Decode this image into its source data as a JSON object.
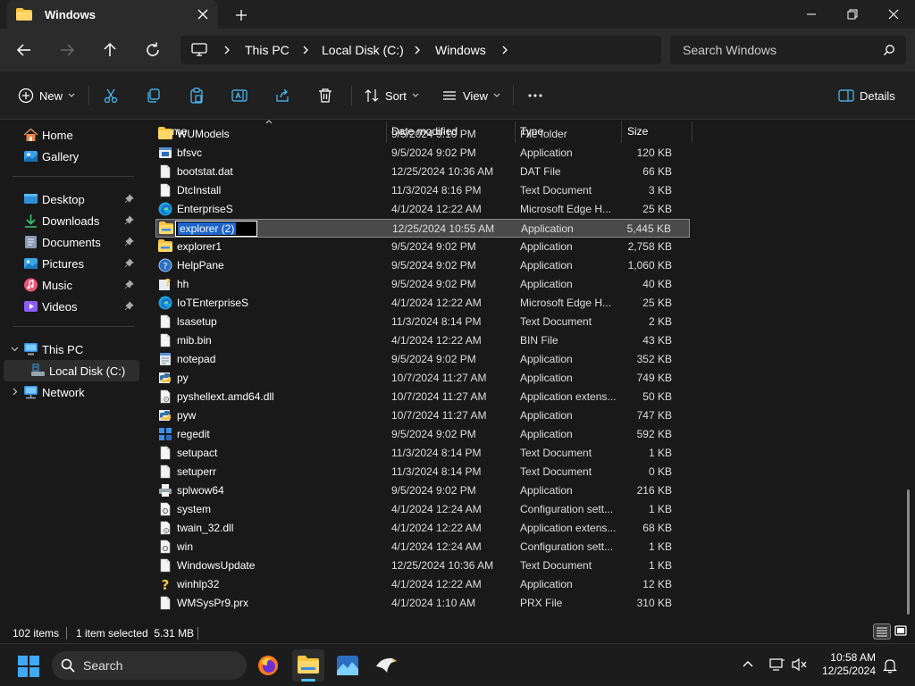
{
  "window": {
    "tab_title": "Windows",
    "controls": [
      "minimize",
      "maximize",
      "close"
    ]
  },
  "address_bar": {
    "breadcrumbs": [
      "This PC",
      "Local Disk (C:)",
      "Windows"
    ]
  },
  "search": {
    "placeholder": "Search Windows"
  },
  "toolbar": {
    "new_label": "New",
    "sort_label": "Sort",
    "view_label": "View",
    "details_label": "Details"
  },
  "sidebar": {
    "quick": [
      {
        "label": "Home",
        "icon": "home-icon"
      },
      {
        "label": "Gallery",
        "icon": "gallery-icon"
      }
    ],
    "pinned": [
      {
        "label": "Desktop",
        "icon": "desktop-icon"
      },
      {
        "label": "Downloads",
        "icon": "downloads-icon"
      },
      {
        "label": "Documents",
        "icon": "documents-icon"
      },
      {
        "label": "Pictures",
        "icon": "pictures-icon"
      },
      {
        "label": "Music",
        "icon": "music-icon"
      },
      {
        "label": "Videos",
        "icon": "videos-icon"
      }
    ],
    "this_pc": "This PC",
    "local_disk": "Local Disk (C:)",
    "network": "Network"
  },
  "columns": {
    "name": "Name",
    "date": "Date modified",
    "type": "Type",
    "size": "Size"
  },
  "files": [
    {
      "name": "WUModels",
      "date": "9/5/2024 9:10 PM",
      "type": "File folder",
      "size": "",
      "icon": "folder"
    },
    {
      "name": "bfsvc",
      "date": "9/5/2024 9:02 PM",
      "type": "Application",
      "size": "120 KB",
      "icon": "app"
    },
    {
      "name": "bootstat.dat",
      "date": "12/25/2024 10:36 AM",
      "type": "DAT File",
      "size": "66 KB",
      "icon": "doc"
    },
    {
      "name": "DtcInstall",
      "date": "11/3/2024 8:16 PM",
      "type": "Text Document",
      "size": "3 KB",
      "icon": "doc"
    },
    {
      "name": "EnterpriseS",
      "date": "4/1/2024 12:22 AM",
      "type": "Microsoft Edge H...",
      "size": "25 KB",
      "icon": "edge"
    },
    {
      "name": "explorer (2)",
      "date": "12/25/2024 10:55 AM",
      "type": "Application",
      "size": "5,445 KB",
      "icon": "explorer",
      "selected": true
    },
    {
      "name": "explorer1",
      "date": "9/5/2024 9:02 PM",
      "type": "Application",
      "size": "2,758 KB",
      "icon": "explorer"
    },
    {
      "name": "HelpPane",
      "date": "9/5/2024 9:02 PM",
      "type": "Application",
      "size": "1,060 KB",
      "icon": "help"
    },
    {
      "name": "hh",
      "date": "9/5/2024 9:02 PM",
      "type": "Application",
      "size": "40 KB",
      "icon": "hh"
    },
    {
      "name": "IoTEnterpriseS",
      "date": "4/1/2024 12:22 AM",
      "type": "Microsoft Edge H...",
      "size": "25 KB",
      "icon": "edge"
    },
    {
      "name": "lsasetup",
      "date": "11/3/2024 8:14 PM",
      "type": "Text Document",
      "size": "2 KB",
      "icon": "doc"
    },
    {
      "name": "mib.bin",
      "date": "4/1/2024 12:22 AM",
      "type": "BIN File",
      "size": "43 KB",
      "icon": "doc"
    },
    {
      "name": "notepad",
      "date": "9/5/2024 9:02 PM",
      "type": "Application",
      "size": "352 KB",
      "icon": "notepad"
    },
    {
      "name": "py",
      "date": "10/7/2024 11:27 AM",
      "type": "Application",
      "size": "749 KB",
      "icon": "python"
    },
    {
      "name": "pyshellext.amd64.dll",
      "date": "10/7/2024 11:27 AM",
      "type": "Application extens...",
      "size": "50 KB",
      "icon": "dll"
    },
    {
      "name": "pyw",
      "date": "10/7/2024 11:27 AM",
      "type": "Application",
      "size": "747 KB",
      "icon": "python"
    },
    {
      "name": "regedit",
      "date": "9/5/2024 9:02 PM",
      "type": "Application",
      "size": "592 KB",
      "icon": "regedit"
    },
    {
      "name": "setupact",
      "date": "11/3/2024 8:14 PM",
      "type": "Text Document",
      "size": "1 KB",
      "icon": "doc"
    },
    {
      "name": "setuperr",
      "date": "11/3/2024 8:14 PM",
      "type": "Text Document",
      "size": "0 KB",
      "icon": "doc"
    },
    {
      "name": "splwow64",
      "date": "9/5/2024 9:02 PM",
      "type": "Application",
      "size": "216 KB",
      "icon": "printer"
    },
    {
      "name": "system",
      "date": "4/1/2024 12:24 AM",
      "type": "Configuration sett...",
      "size": "1 KB",
      "icon": "config"
    },
    {
      "name": "twain_32.dll",
      "date": "4/1/2024 12:22 AM",
      "type": "Application extens...",
      "size": "68 KB",
      "icon": "dll"
    },
    {
      "name": "win",
      "date": "4/1/2024 12:24 AM",
      "type": "Configuration sett...",
      "size": "1 KB",
      "icon": "config"
    },
    {
      "name": "WindowsUpdate",
      "date": "12/25/2024 10:36 AM",
      "type": "Text Document",
      "size": "1 KB",
      "icon": "doc"
    },
    {
      "name": "winhlp32",
      "date": "4/1/2024 12:22 AM",
      "type": "Application",
      "size": "12 KB",
      "icon": "winhlp"
    },
    {
      "name": "WMSysPr9.prx",
      "date": "4/1/2024 1:10 AM",
      "type": "PRX File",
      "size": "310 KB",
      "icon": "doc"
    }
  ],
  "rename": {
    "value": "explorer (2)"
  },
  "status": {
    "item_count": "102 items",
    "selection": "1 item selected  5.31 MB"
  },
  "taskbar": {
    "search_placeholder": "Search",
    "time": "10:58 AM",
    "date": "12/25/2024"
  },
  "colors": {
    "accent": "#4cc2ff",
    "selection_highlight": "#1d63c9",
    "folder_yellow": "#f4c542",
    "background": "#191919"
  }
}
